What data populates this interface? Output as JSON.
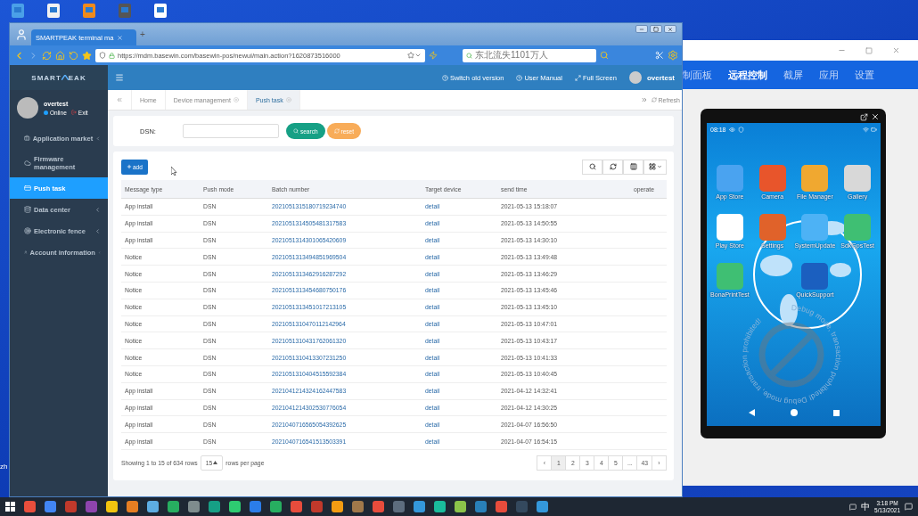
{
  "desktop": {
    "edge_text": "zh"
  },
  "browser": {
    "tab_title": "SMARTPEAK terminal ma",
    "new_tab": "+",
    "url": "https://mdm.basewin.com/basewin-pos/newui/main.action?1620873516000",
    "search_value": "东北流失1101万人"
  },
  "header": {
    "logo_left": "SMART",
    "logo_right": "EAK",
    "links": [
      "Switch old version",
      "User Manual",
      "Full Screen"
    ],
    "user": "overtest"
  },
  "sidebar": {
    "user": "overtest",
    "status": "Online",
    "exit": "Exit",
    "items": [
      {
        "label": "Application market",
        "expandable": true,
        "selected": false
      },
      {
        "label": "Firmware management",
        "expandable": false,
        "selected": false
      },
      {
        "label": "Push task",
        "expandable": false,
        "selected": true
      },
      {
        "label": "Data center",
        "expandable": true,
        "selected": false
      },
      {
        "label": "Electronic fence",
        "expandable": true,
        "selected": false
      },
      {
        "label": "Account information",
        "expandable": true,
        "selected": false
      }
    ]
  },
  "tabs": [
    {
      "label": "Home",
      "closable": false,
      "selected": false
    },
    {
      "label": "Device management",
      "closable": true,
      "selected": false
    },
    {
      "label": "Push task",
      "closable": true,
      "selected": true
    }
  ],
  "refresh": "Refresh",
  "filter": {
    "label": "DSN:",
    "search": "search",
    "reset": "reset"
  },
  "table": {
    "add": "add",
    "columns": [
      {
        "label": "Message type",
        "kind": "text"
      },
      {
        "label": "Push mode",
        "kind": "text"
      },
      {
        "label": "Batch number",
        "kind": "link"
      },
      {
        "label": "Target device",
        "kind": "link"
      },
      {
        "label": "send time",
        "kind": "text"
      },
      {
        "label": "operate"
      }
    ],
    "rows": [
      [
        "App install",
        "DSN",
        "2021051315180719234740",
        "detail",
        "2021-05-13 15:18:07"
      ],
      [
        "App install",
        "DSN",
        "2021051314505481317583",
        "detail",
        "2021-05-13 14:50:55"
      ],
      [
        "App install",
        "DSN",
        "2021051314301065420609",
        "detail",
        "2021-05-13 14:30:10"
      ],
      [
        "Notice",
        "DSN",
        "2021051313494851969504",
        "detail",
        "2021-05-13 13:49:48"
      ],
      [
        "Notice",
        "DSN",
        "2021051313462916287292",
        "detail",
        "2021-05-13 13:46:29"
      ],
      [
        "Notice",
        "DSN",
        "2021051313454680750176",
        "detail",
        "2021-05-13 13:45:46"
      ],
      [
        "Notice",
        "DSN",
        "2021051313451017213105",
        "detail",
        "2021-05-13 13:45:10"
      ],
      [
        "Notice",
        "DSN",
        "2021051310470112142964",
        "detail",
        "2021-05-13 10:47:01"
      ],
      [
        "Notice",
        "DSN",
        "2021051310431762061320",
        "detail",
        "2021-05-13 10:43:17"
      ],
      [
        "Notice",
        "DSN",
        "2021051310413307231250",
        "detail",
        "2021-05-13 10:41:33"
      ],
      [
        "Notice",
        "DSN",
        "2021051310404515592384",
        "detail",
        "2021-05-13 10:40:45"
      ],
      [
        "App install",
        "DSN",
        "2021041214324162447583",
        "detail",
        "2021-04-12 14:32:41"
      ],
      [
        "App install",
        "DSN",
        "2021041214302530776054",
        "detail",
        "2021-04-12 14:30:25"
      ],
      [
        "App install",
        "DSN",
        "2021040716565054392625",
        "detail",
        "2021-04-07 16:56:50"
      ],
      [
        "App install",
        "DSN",
        "2021040716541513503391",
        "detail",
        "2021-04-07 16:54:15"
      ]
    ],
    "summary": "Showing 1 to 15 of 634 rows",
    "page_size": "15",
    "per_page": "rows per page",
    "pages": [
      {
        "label": "‹",
        "selected": false
      },
      {
        "label": "1",
        "selected": true
      },
      {
        "label": "2",
        "selected": false
      },
      {
        "label": "3",
        "selected": false
      },
      {
        "label": "4",
        "selected": false
      },
      {
        "label": "5",
        "selected": false
      },
      {
        "label": "...",
        "selected": false
      },
      {
        "label": "43",
        "selected": false
      },
      {
        "label": "›",
        "selected": false
      }
    ]
  },
  "remote": {
    "nav": [
      {
        "label": "制面板",
        "selected": false
      },
      {
        "label": "远程控制",
        "selected": true
      },
      {
        "label": "截屏",
        "selected": false
      },
      {
        "label": "应用",
        "selected": false
      },
      {
        "label": "设置",
        "selected": false
      }
    ],
    "phone": {
      "time": "08:18",
      "apps": [
        {
          "kind": "app",
          "label": "App Store"
        },
        {
          "kind": "app",
          "label": "Camera"
        },
        {
          "kind": "app",
          "label": "File Manager"
        },
        {
          "kind": "app",
          "label": "Gallery"
        },
        {
          "kind": "app",
          "label": "Play Store"
        },
        {
          "kind": "app",
          "label": "Settings"
        },
        {
          "kind": "app",
          "label": "SystemUpdate"
        },
        {
          "kind": "app",
          "label": "SdkGpsTest"
        },
        {
          "kind": "app",
          "label": "BonaPrintTest"
        },
        {
          "kind": "blank"
        },
        {
          "kind": "app",
          "label": "QuickSupport"
        }
      ],
      "watermark": "Debug mode, transaction prohibited! Debug mode, transaction prohibited!"
    }
  },
  "taskbar": {
    "ime": "中",
    "time": "3:18 PM",
    "date": "5/13/2021"
  }
}
